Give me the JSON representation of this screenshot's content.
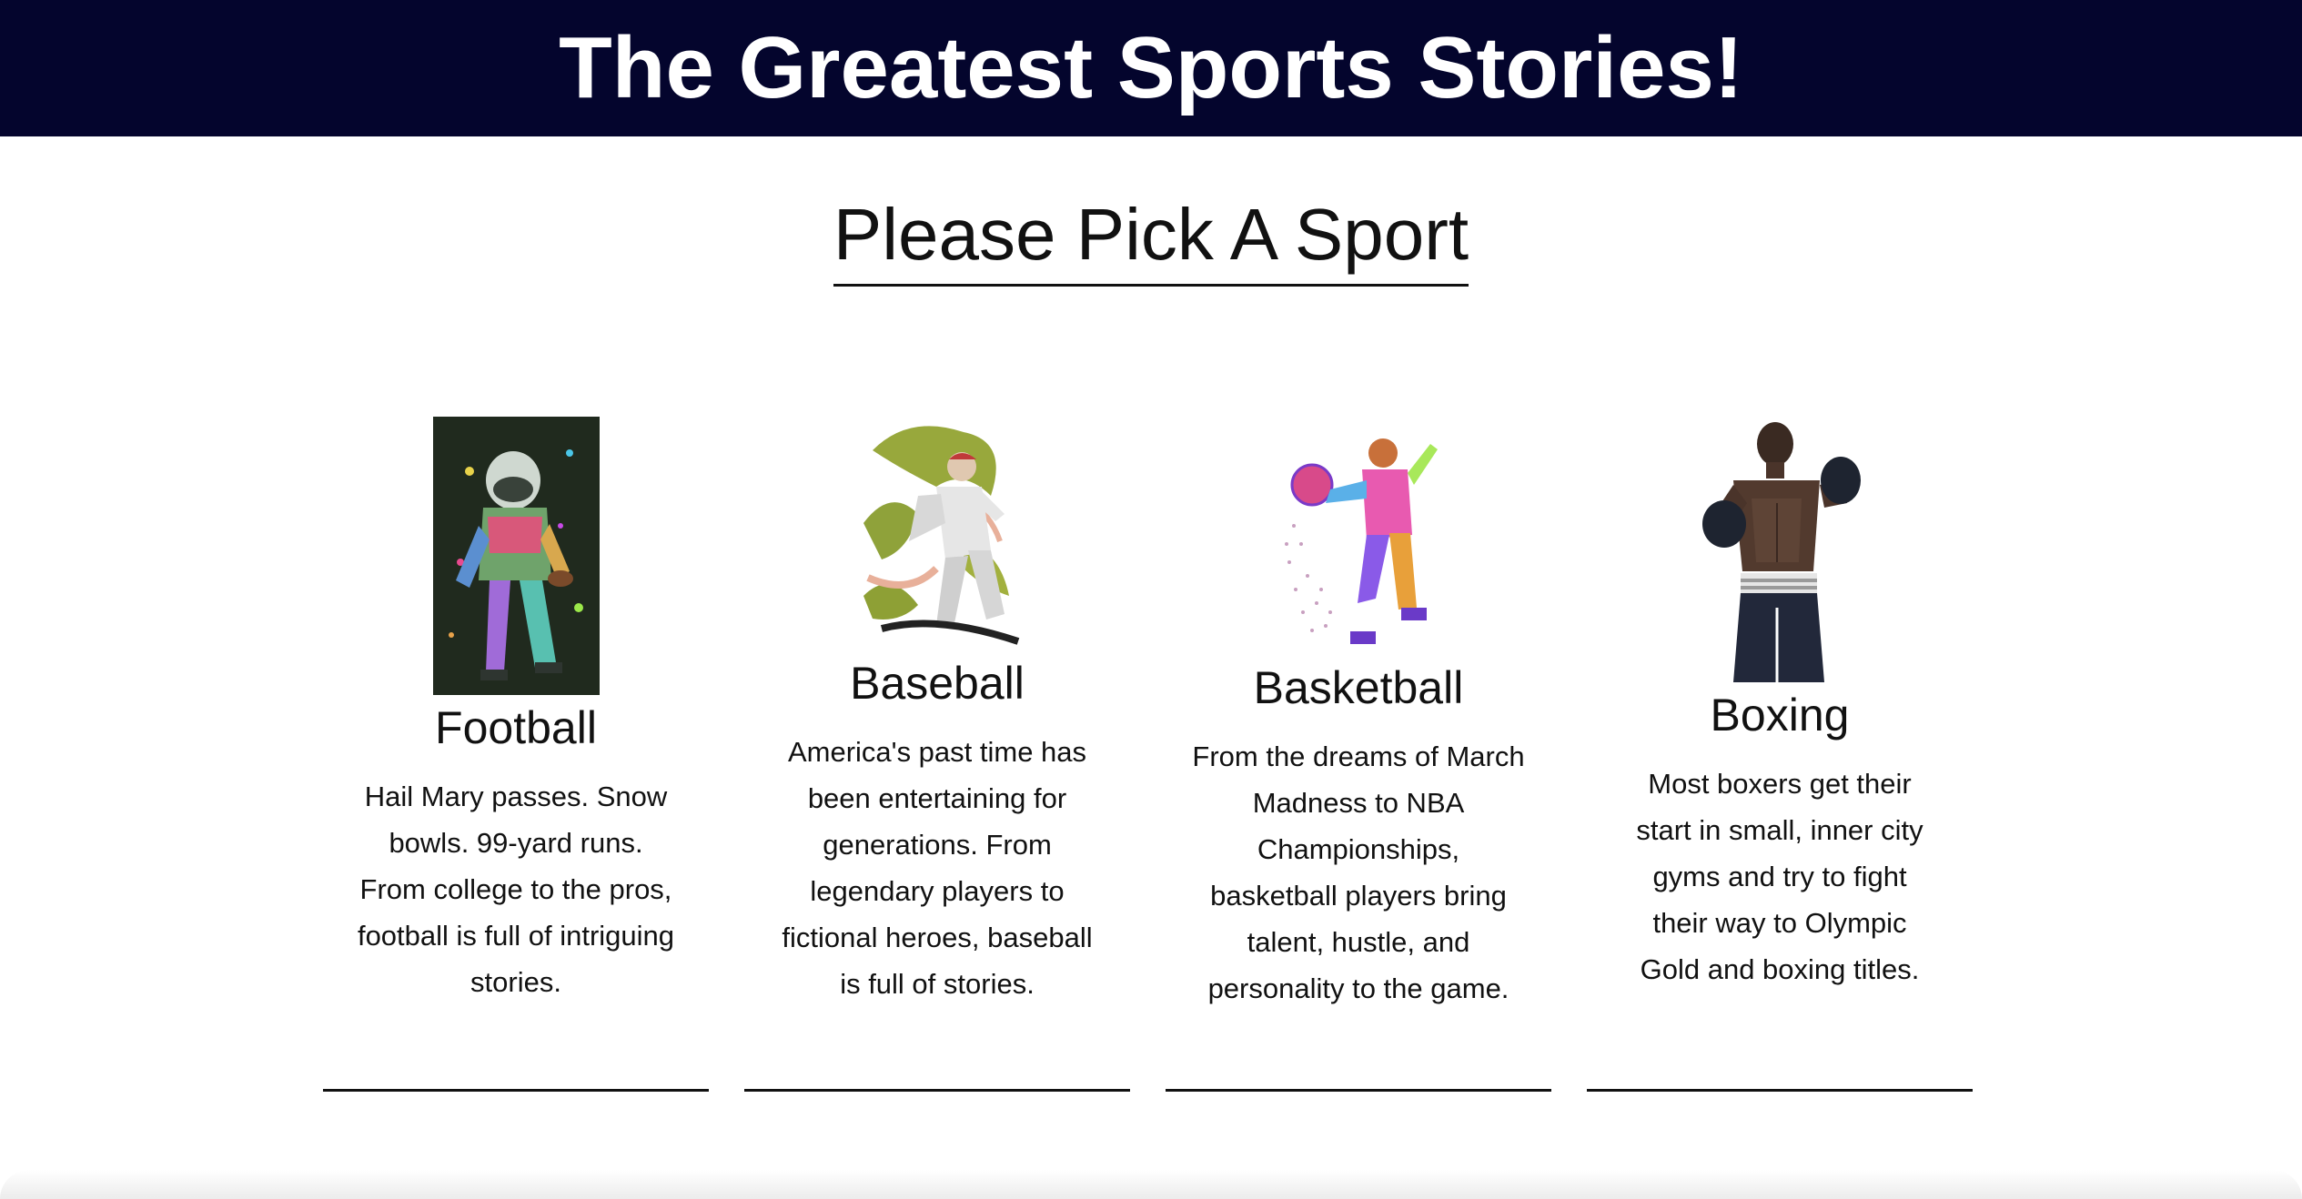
{
  "header": {
    "title": "The Greatest Sports Stories!"
  },
  "main": {
    "heading": "Please Pick A Sport",
    "sports": [
      {
        "name": "Football",
        "description": "Hail Mary passes. Snow bowls. 99-yard runs. From college to the pros, football is full of intriguing stories.",
        "icon": "football-player-image"
      },
      {
        "name": "Baseball",
        "description": "America's past time has been entertaining for generations. From legendary players to fictional heroes, baseball is full of stories.",
        "icon": "baseball-player-image"
      },
      {
        "name": "Basketball",
        "description": "From the dreams of March Madness to NBA Championships, basketball players bring talent, hustle, and personality to the game.",
        "icon": "basketball-player-image"
      },
      {
        "name": "Boxing",
        "description": "Most boxers get their start in small, inner city gyms and try to fight their way to Olympic Gold and boxing titles.",
        "icon": "boxer-image"
      }
    ]
  },
  "colors": {
    "header_bg": "#04052d",
    "header_text": "#ffffff",
    "text": "#111111"
  }
}
